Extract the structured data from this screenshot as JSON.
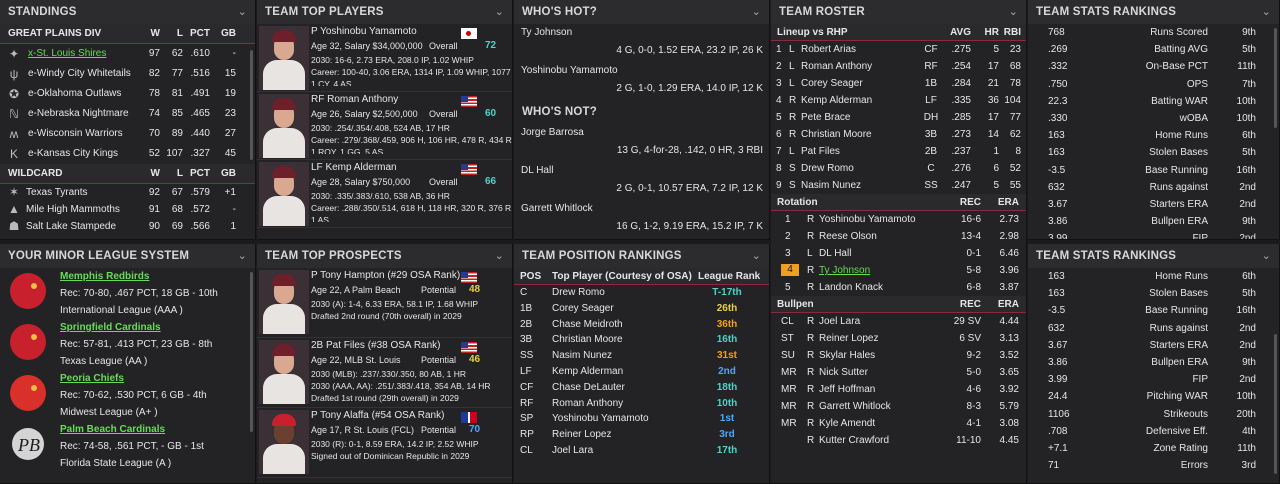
{
  "standings": {
    "title": "STANDINGS",
    "div_header": {
      "name": "GREAT PLAINS DIV",
      "w": "W",
      "l": "L",
      "pct": "PCT",
      "gb": "GB"
    },
    "div_rows": [
      {
        "team": "x-St. Louis Shires",
        "w": "97",
        "l": "62",
        "pct": ".610",
        "gb": "-",
        "link": true
      },
      {
        "team": "e-Windy City Whitetails",
        "w": "82",
        "l": "77",
        "pct": ".516",
        "gb": "15"
      },
      {
        "team": "e-Oklahoma Outlaws",
        "w": "78",
        "l": "81",
        "pct": ".491",
        "gb": "19"
      },
      {
        "team": "e-Nebraska Nightmare",
        "w": "74",
        "l": "85",
        "pct": ".465",
        "gb": "23"
      },
      {
        "team": "e-Wisconsin Warriors",
        "w": "70",
        "l": "89",
        "pct": ".440",
        "gb": "27"
      },
      {
        "team": "e-Kansas City Kings",
        "w": "52",
        "l": "107",
        "pct": ".327",
        "gb": "45"
      }
    ],
    "wc_header": {
      "name": "WILDCARD",
      "w": "W",
      "l": "L",
      "pct": "PCT",
      "gb": "GB"
    },
    "wc_rows": [
      {
        "team": "Texas Tyrants",
        "w": "92",
        "l": "67",
        "pct": ".579",
        "gb": "+1"
      },
      {
        "team": "Mile High Mammoths",
        "w": "91",
        "l": "68",
        "pct": ".572",
        "gb": "-"
      },
      {
        "team": "Salt Lake Stampede",
        "w": "90",
        "l": "69",
        "pct": ".566",
        "gb": "1"
      }
    ]
  },
  "top_players": {
    "title": "TEAM TOP PLAYERS",
    "players": [
      {
        "name": "P Yoshinobu Yamamoto",
        "info": "Age 32, Salary $34,000,000",
        "ovr_label": "Overall",
        "ovr": "72",
        "flag": "jp",
        "l1": "2030: 16-6, 2.73 ERA, 208.0 IP, 1.02 WHIP",
        "l2": "Career: 100-40, 3.06 ERA, 1314 IP, 1.09 WHIP, 1077",
        "l3": "1 CY, 4 AS"
      },
      {
        "name": "RF Roman Anthony",
        "info": "Age 26, Salary $2,500,000",
        "ovr_label": "Overall",
        "ovr": "60",
        "flag": "us",
        "l1": "2030: .254/.354/.408, 524 AB, 17 HR",
        "l2": "Career: .279/.368/.459, 906 H, 106 HR, 478 R, 434 R",
        "l3": "1 ROY, 1 GG, 5 AS"
      },
      {
        "name": "LF Kemp Alderman",
        "info": "Age 28, Salary $750,000",
        "ovr_label": "Overall",
        "ovr": "66",
        "flag": "us",
        "l1": "2030: .335/.383/.610, 538 AB, 36 HR",
        "l2": "Career: .288/.350/.514, 618 H, 118 HR, 320 R, 376 R",
        "l3": "1 AS"
      }
    ]
  },
  "whos_hot": {
    "title": "WHO'S HOT?",
    "players": [
      {
        "name": "Ty Johnson",
        "line": "4 G, 0-0, 1.52 ERA, 23.2 IP, 26 K"
      },
      {
        "name": "Yoshinobu Yamamoto",
        "line": "2 G, 1-0, 1.29 ERA, 14.0 IP, 12 K"
      }
    ]
  },
  "whos_not": {
    "title": "WHO'S NOT?",
    "players": [
      {
        "name": "Jorge Barrosa",
        "line": "13 G, 4-for-28, .142, 0 HR, 3 RBI"
      },
      {
        "name": "DL Hall",
        "line": "2 G, 0-1, 10.57 ERA, 7.2 IP, 12 K"
      },
      {
        "name": "Garrett Whitlock",
        "line": "16 G, 1-2, 9.19 ERA, 15.2 IP, 7 K"
      }
    ]
  },
  "roster": {
    "title": "TEAM ROSTER",
    "lineup_header": {
      "label": "Lineup vs RHP",
      "avg": "AVG",
      "hr": "HR",
      "rbi": "RBI"
    },
    "lineup": [
      {
        "n": "1",
        "h": "L",
        "name": "Robert Arias",
        "pos": "CF",
        "avg": ".275",
        "hr": "5",
        "rbi": "23"
      },
      {
        "n": "2",
        "h": "L",
        "name": "Roman Anthony",
        "pos": "RF",
        "avg": ".254",
        "hr": "17",
        "rbi": "68"
      },
      {
        "n": "3",
        "h": "L",
        "name": "Corey Seager",
        "pos": "1B",
        "avg": ".284",
        "hr": "21",
        "rbi": "78"
      },
      {
        "n": "4",
        "h": "R",
        "name": "Kemp Alderman",
        "pos": "LF",
        "avg": ".335",
        "hr": "36",
        "rbi": "104"
      },
      {
        "n": "5",
        "h": "R",
        "name": "Pete Brace",
        "pos": "DH",
        "avg": ".285",
        "hr": "17",
        "rbi": "77"
      },
      {
        "n": "6",
        "h": "R",
        "name": "Christian Moore",
        "pos": "3B",
        "avg": ".273",
        "hr": "14",
        "rbi": "62"
      },
      {
        "n": "7",
        "h": "L",
        "name": "Pat Files",
        "pos": "2B",
        "avg": ".237",
        "hr": "1",
        "rbi": "8"
      },
      {
        "n": "8",
        "h": "S",
        "name": "Drew Romo",
        "pos": "C",
        "avg": ".276",
        "hr": "6",
        "rbi": "52"
      },
      {
        "n": "9",
        "h": "S",
        "name": "Nasim Nunez",
        "pos": "SS",
        "avg": ".247",
        "hr": "5",
        "rbi": "55"
      }
    ],
    "rotation_header": {
      "label": "Rotation",
      "rec": "REC",
      "era": "ERA"
    },
    "rotation": [
      {
        "n": "1",
        "h": "R",
        "name": "Yoshinobu Yamamoto",
        "rec": "16-6",
        "era": "2.73"
      },
      {
        "n": "2",
        "h": "R",
        "name": "Reese Olson",
        "rec": "13-4",
        "era": "2.98"
      },
      {
        "n": "3",
        "h": "L",
        "name": "DL Hall",
        "rec": "0-1",
        "era": "6.46"
      },
      {
        "n": "4",
        "h": "R",
        "name": "Ty Johnson",
        "rec": "5-8",
        "era": "3.96",
        "link": true
      },
      {
        "n": "5",
        "h": "R",
        "name": "Landon Knack",
        "rec": "6-8",
        "era": "3.87"
      }
    ],
    "bullpen_header": {
      "label": "Bullpen",
      "rec": "REC",
      "era": "ERA"
    },
    "bullpen": [
      {
        "role": "CL",
        "h": "R",
        "name": "Joel Lara",
        "rec": "29 SV",
        "era": "4.44"
      },
      {
        "role": "ST",
        "h": "R",
        "name": "Reiner Lopez",
        "rec": "6 SV",
        "era": "3.13"
      },
      {
        "role": "SU",
        "h": "R",
        "name": "Skylar Hales",
        "rec": "9-2",
        "era": "3.52"
      },
      {
        "role": "MR",
        "h": "R",
        "name": "Nick Sutter",
        "rec": "5-0",
        "era": "3.65"
      },
      {
        "role": "MR",
        "h": "R",
        "name": "Jeff Hoffman",
        "rec": "4-6",
        "era": "3.92"
      },
      {
        "role": "MR",
        "h": "R",
        "name": "Garrett Whitlock",
        "rec": "8-3",
        "era": "5.79"
      },
      {
        "role": "MR",
        "h": "R",
        "name": "Kyle Amendt",
        "rec": "4-1",
        "era": "3.08"
      },
      {
        "role": "",
        "h": "R",
        "name": "Kutter Crawford",
        "rec": "11-10",
        "era": "4.45"
      }
    ]
  },
  "stats1": {
    "title": "TEAM STATS RANKINGS",
    "rows": [
      {
        "v": "768",
        "s": "Runs Scored",
        "r": "9th"
      },
      {
        "v": ".269",
        "s": "Batting AVG",
        "r": "5th"
      },
      {
        "v": ".332",
        "s": "On-Base PCT",
        "r": "11th"
      },
      {
        "v": ".750",
        "s": "OPS",
        "r": "7th"
      },
      {
        "v": "22.3",
        "s": "Batting WAR",
        "r": "10th"
      },
      {
        "v": ".330",
        "s": "wOBA",
        "r": "10th"
      },
      {
        "v": "163",
        "s": "Home Runs",
        "r": "6th"
      },
      {
        "v": "163",
        "s": "Stolen Bases",
        "r": "5th"
      },
      {
        "v": "-3.5",
        "s": "Base Running",
        "r": "16th"
      },
      {
        "v": "632",
        "s": "Runs against",
        "r": "2nd"
      },
      {
        "v": "3.67",
        "s": "Starters ERA",
        "r": "2nd"
      },
      {
        "v": "3.86",
        "s": "Bullpen ERA",
        "r": "9th"
      },
      {
        "v": "3.99",
        "s": "FIP",
        "r": "2nd"
      }
    ]
  },
  "stats2": {
    "title": "TEAM STATS RANKINGS",
    "rows": [
      {
        "v": "163",
        "s": "Home Runs",
        "r": "6th"
      },
      {
        "v": "163",
        "s": "Stolen Bases",
        "r": "5th"
      },
      {
        "v": "-3.5",
        "s": "Base Running",
        "r": "16th"
      },
      {
        "v": "632",
        "s": "Runs against",
        "r": "2nd"
      },
      {
        "v": "3.67",
        "s": "Starters ERA",
        "r": "2nd"
      },
      {
        "v": "3.86",
        "s": "Bullpen ERA",
        "r": "9th"
      },
      {
        "v": "3.99",
        "s": "FIP",
        "r": "2nd"
      },
      {
        "v": "24.4",
        "s": "Pitching WAR",
        "r": "10th"
      },
      {
        "v": "1106",
        "s": "Strikeouts",
        "r": "20th"
      },
      {
        "v": ".708",
        "s": "Defensive Eff.",
        "r": "4th"
      },
      {
        "v": "+7.1",
        "s": "Zone Rating",
        "r": "11th"
      },
      {
        "v": "71",
        "s": "Errors",
        "r": "3rd"
      }
    ]
  },
  "minor": {
    "title": "YOUR MINOR LEAGUE SYSTEM",
    "teams": [
      {
        "name": "Memphis Redbirds",
        "rec": "Rec: 70-80, .467 PCT, 18 GB - 10th",
        "league": "International League (AAA )"
      },
      {
        "name": "Springfield Cardinals",
        "rec": "Rec: 57-81, .413 PCT, 23 GB - 8th",
        "league": "Texas League (AA )"
      },
      {
        "name": "Peoria Chiefs",
        "rec": "Rec: 70-62, .530 PCT, 6 GB - 4th",
        "league": "Midwest League (A+ )"
      },
      {
        "name": "Palm Beach Cardinals",
        "rec": "Rec: 74-58, .561 PCT, - GB - 1st",
        "league": "Florida State League (A )"
      }
    ]
  },
  "prospects": {
    "title": "TEAM TOP PROSPECTS",
    "players": [
      {
        "name": "P Tony Hampton (#29 OSA Rank)",
        "info": "Age 22, A Palm Beach",
        "pot_label": "Potential",
        "pot": "48",
        "flag": "us",
        "l1": "2030 (A): 1-4, 6.33 ERA, 58.1 IP, 1.68 WHIP",
        "l2": "Drafted 2nd round (70th overall) in 2029"
      },
      {
        "name": "2B Pat Files (#38 OSA Rank)",
        "info": "Age 22, MLB St. Louis",
        "pot_label": "Potential",
        "pot": "46",
        "flag": "us",
        "l1": "2030 (MLB): .237/.330/.350, 80 AB, 1 HR",
        "l2": "2030 (AAA, AA): .251/.383/.418, 354 AB, 14 HR",
        "l3": "Drafted 1st round (29th overall) in 2029"
      },
      {
        "name": "P Tony Alaffa (#54 OSA Rank)",
        "info": "Age 17, R St. Louis (FCL)",
        "pot_label": "Potential",
        "pot": "70",
        "flag": "do",
        "l1": "2030 (R): 0-1, 8.59 ERA, 14.2 IP, 2.52 WHIP",
        "l2": "Signed out of Dominican Republic in 2029"
      }
    ]
  },
  "positions": {
    "title": "TEAM POSITION RANKINGS",
    "header": {
      "pos": "POS",
      "player": "Top Player (Courtesy of OSA)",
      "rank": "League Rank"
    },
    "rows": [
      {
        "pos": "C",
        "player": "Drew Romo",
        "rank": "T-17th",
        "cls": "teal"
      },
      {
        "pos": "1B",
        "player": "Corey Seager",
        "rank": "26th",
        "cls": "yel"
      },
      {
        "pos": "2B",
        "player": "Chase Meidroth",
        "rank": "36th",
        "cls": "orange"
      },
      {
        "pos": "3B",
        "player": "Christian Moore",
        "rank": "16th",
        "cls": "teal"
      },
      {
        "pos": "SS",
        "player": "Nasim Nunez",
        "rank": "31st",
        "cls": "orange"
      },
      {
        "pos": "LF",
        "player": "Kemp Alderman",
        "rank": "2nd",
        "cls": "blue"
      },
      {
        "pos": "CF",
        "player": "Chase DeLauter",
        "rank": "18th",
        "cls": "teal"
      },
      {
        "pos": "RF",
        "player": "Roman Anthony",
        "rank": "10th",
        "cls": "teal"
      },
      {
        "pos": "SP",
        "player": "Yoshinobu Yamamoto",
        "rank": "1st",
        "cls": "blue"
      },
      {
        "pos": "RP",
        "player": "Reiner Lopez",
        "rank": "3rd",
        "cls": "blue"
      },
      {
        "pos": "CL",
        "player": "Joel Lara",
        "rank": "17th",
        "cls": "teal"
      }
    ]
  },
  "chevron": "⌄"
}
